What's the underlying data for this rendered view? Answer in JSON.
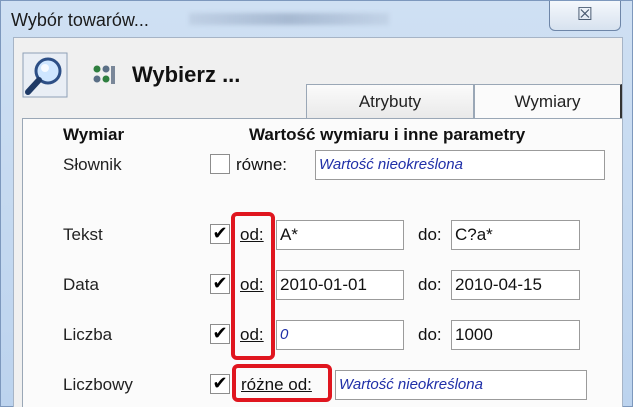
{
  "window": {
    "title": "Wybór towarów...",
    "close_symbol": "☒"
  },
  "header": {
    "title": "Wybierz ...",
    "icons": [
      "magnifier-icon",
      "filter-dots-icon"
    ]
  },
  "tabs": [
    {
      "label": "Atrybuty",
      "active": false
    },
    {
      "label": "Wymiary",
      "active": true
    }
  ],
  "columns": {
    "dimension": "Wymiar",
    "value": "Wartość wymiaru i inne parametry"
  },
  "rows": [
    {
      "label": "Słownik",
      "checked": false,
      "op": "równe:",
      "value": "Wartość nieokreślona",
      "value_is_placeholder": true
    },
    {
      "label": "Tekst",
      "checked": true,
      "op": "od:",
      "value": "A*",
      "to_label": "do:",
      "to_value": "C?a*"
    },
    {
      "label": "Data",
      "checked": true,
      "op": "od:",
      "value": "2010-01-01",
      "to_label": "do:",
      "to_value": "2010-04-15"
    },
    {
      "label": "Liczba",
      "checked": true,
      "op": "od:",
      "value": "0",
      "value_is_placeholder": true,
      "to_label": "do:",
      "to_value": "1000"
    },
    {
      "label": "Liczbowy",
      "checked": true,
      "op": "różne od:",
      "value": "Wartość nieokreślona",
      "value_is_placeholder": true
    }
  ],
  "colors": {
    "highlight": "#e0161f",
    "placeholder_text": "#1f2fa8",
    "window_frame": "#bcd3ee"
  }
}
